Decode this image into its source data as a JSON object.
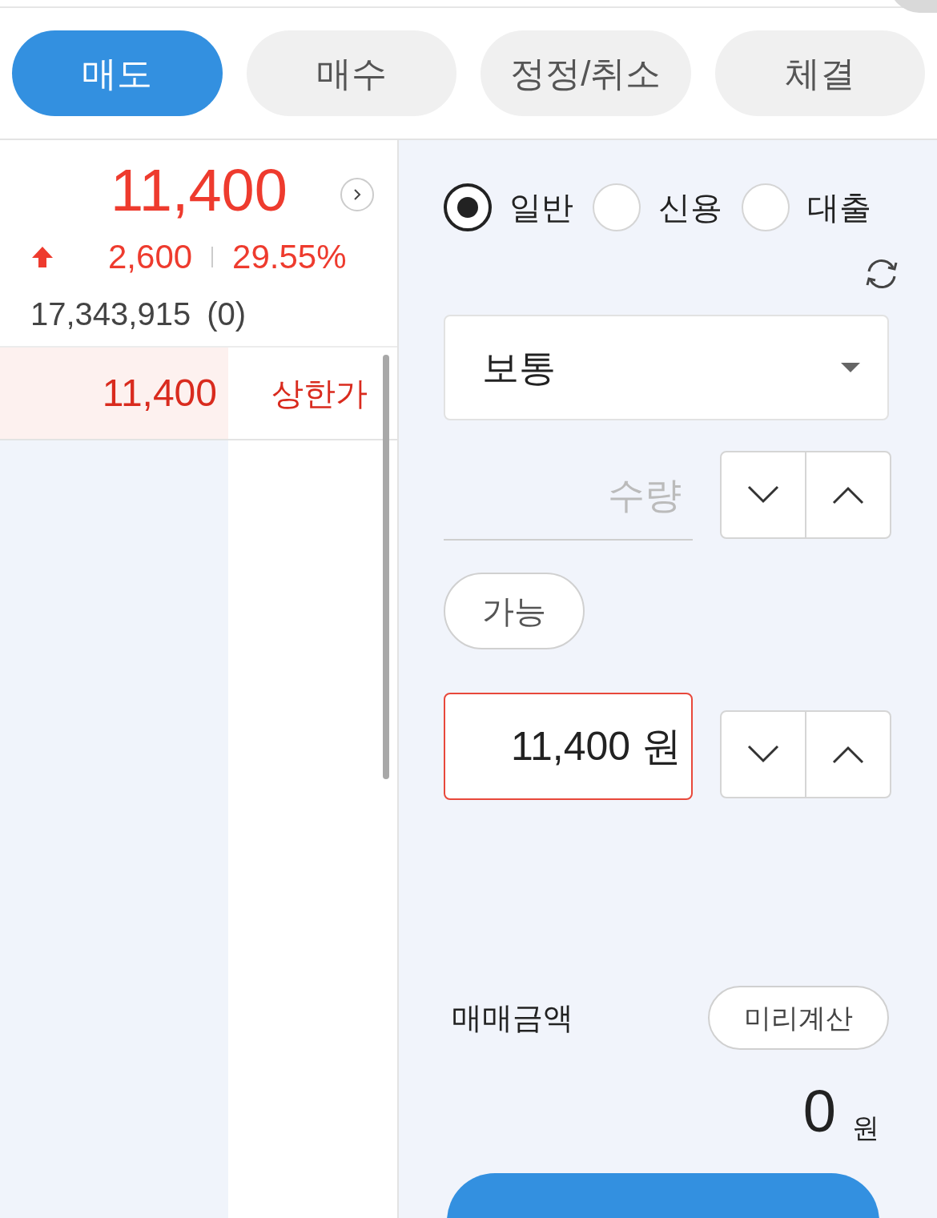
{
  "tabs": [
    {
      "label": "매도",
      "selected": true
    },
    {
      "label": "매수",
      "selected": false
    },
    {
      "label": "정정/취소",
      "selected": false
    },
    {
      "label": "체결",
      "selected": false
    }
  ],
  "quote": {
    "price": "11,400",
    "rising": true,
    "change": "2,600",
    "rate": "29.55%",
    "volume": "17,343,915",
    "volume_change": "(0)"
  },
  "order_book": [
    {
      "price": "11,400",
      "label": "상한가"
    }
  ],
  "order_types": [
    {
      "label": "일반",
      "selected": true
    },
    {
      "label": "신용",
      "selected": false
    },
    {
      "label": "대출",
      "selected": false
    }
  ],
  "condition": {
    "value": "보통"
  },
  "quantity": {
    "placeholder": "수량"
  },
  "available_button": "가능",
  "price_field": {
    "value": "11,400 원"
  },
  "amount": {
    "label": "매매금액",
    "calc_button": "미리계산",
    "total": "0",
    "unit": "원"
  }
}
